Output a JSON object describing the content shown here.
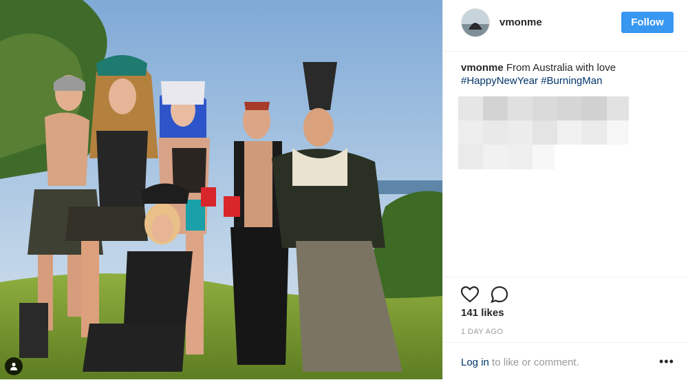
{
  "post": {
    "username": "vmonme",
    "follow_label": "Follow",
    "caption_username": "vmonme",
    "caption_text": " From Australia with love",
    "hashtags": [
      "#HappyNewYear",
      "#BurningMan"
    ],
    "likes": "141 likes",
    "time_ago": "1 DAY AGO",
    "login_link": "Log in",
    "login_rest": " to like or comment.",
    "more_label": "•••"
  },
  "icons": {
    "tag": "person-tag-icon",
    "like": "heart-icon",
    "comment": "comment-bubble-icon",
    "more": "more-options-icon"
  },
  "colors": {
    "follow_button": "#3897f0",
    "hashtag": "#003569",
    "muted": "#999999"
  }
}
